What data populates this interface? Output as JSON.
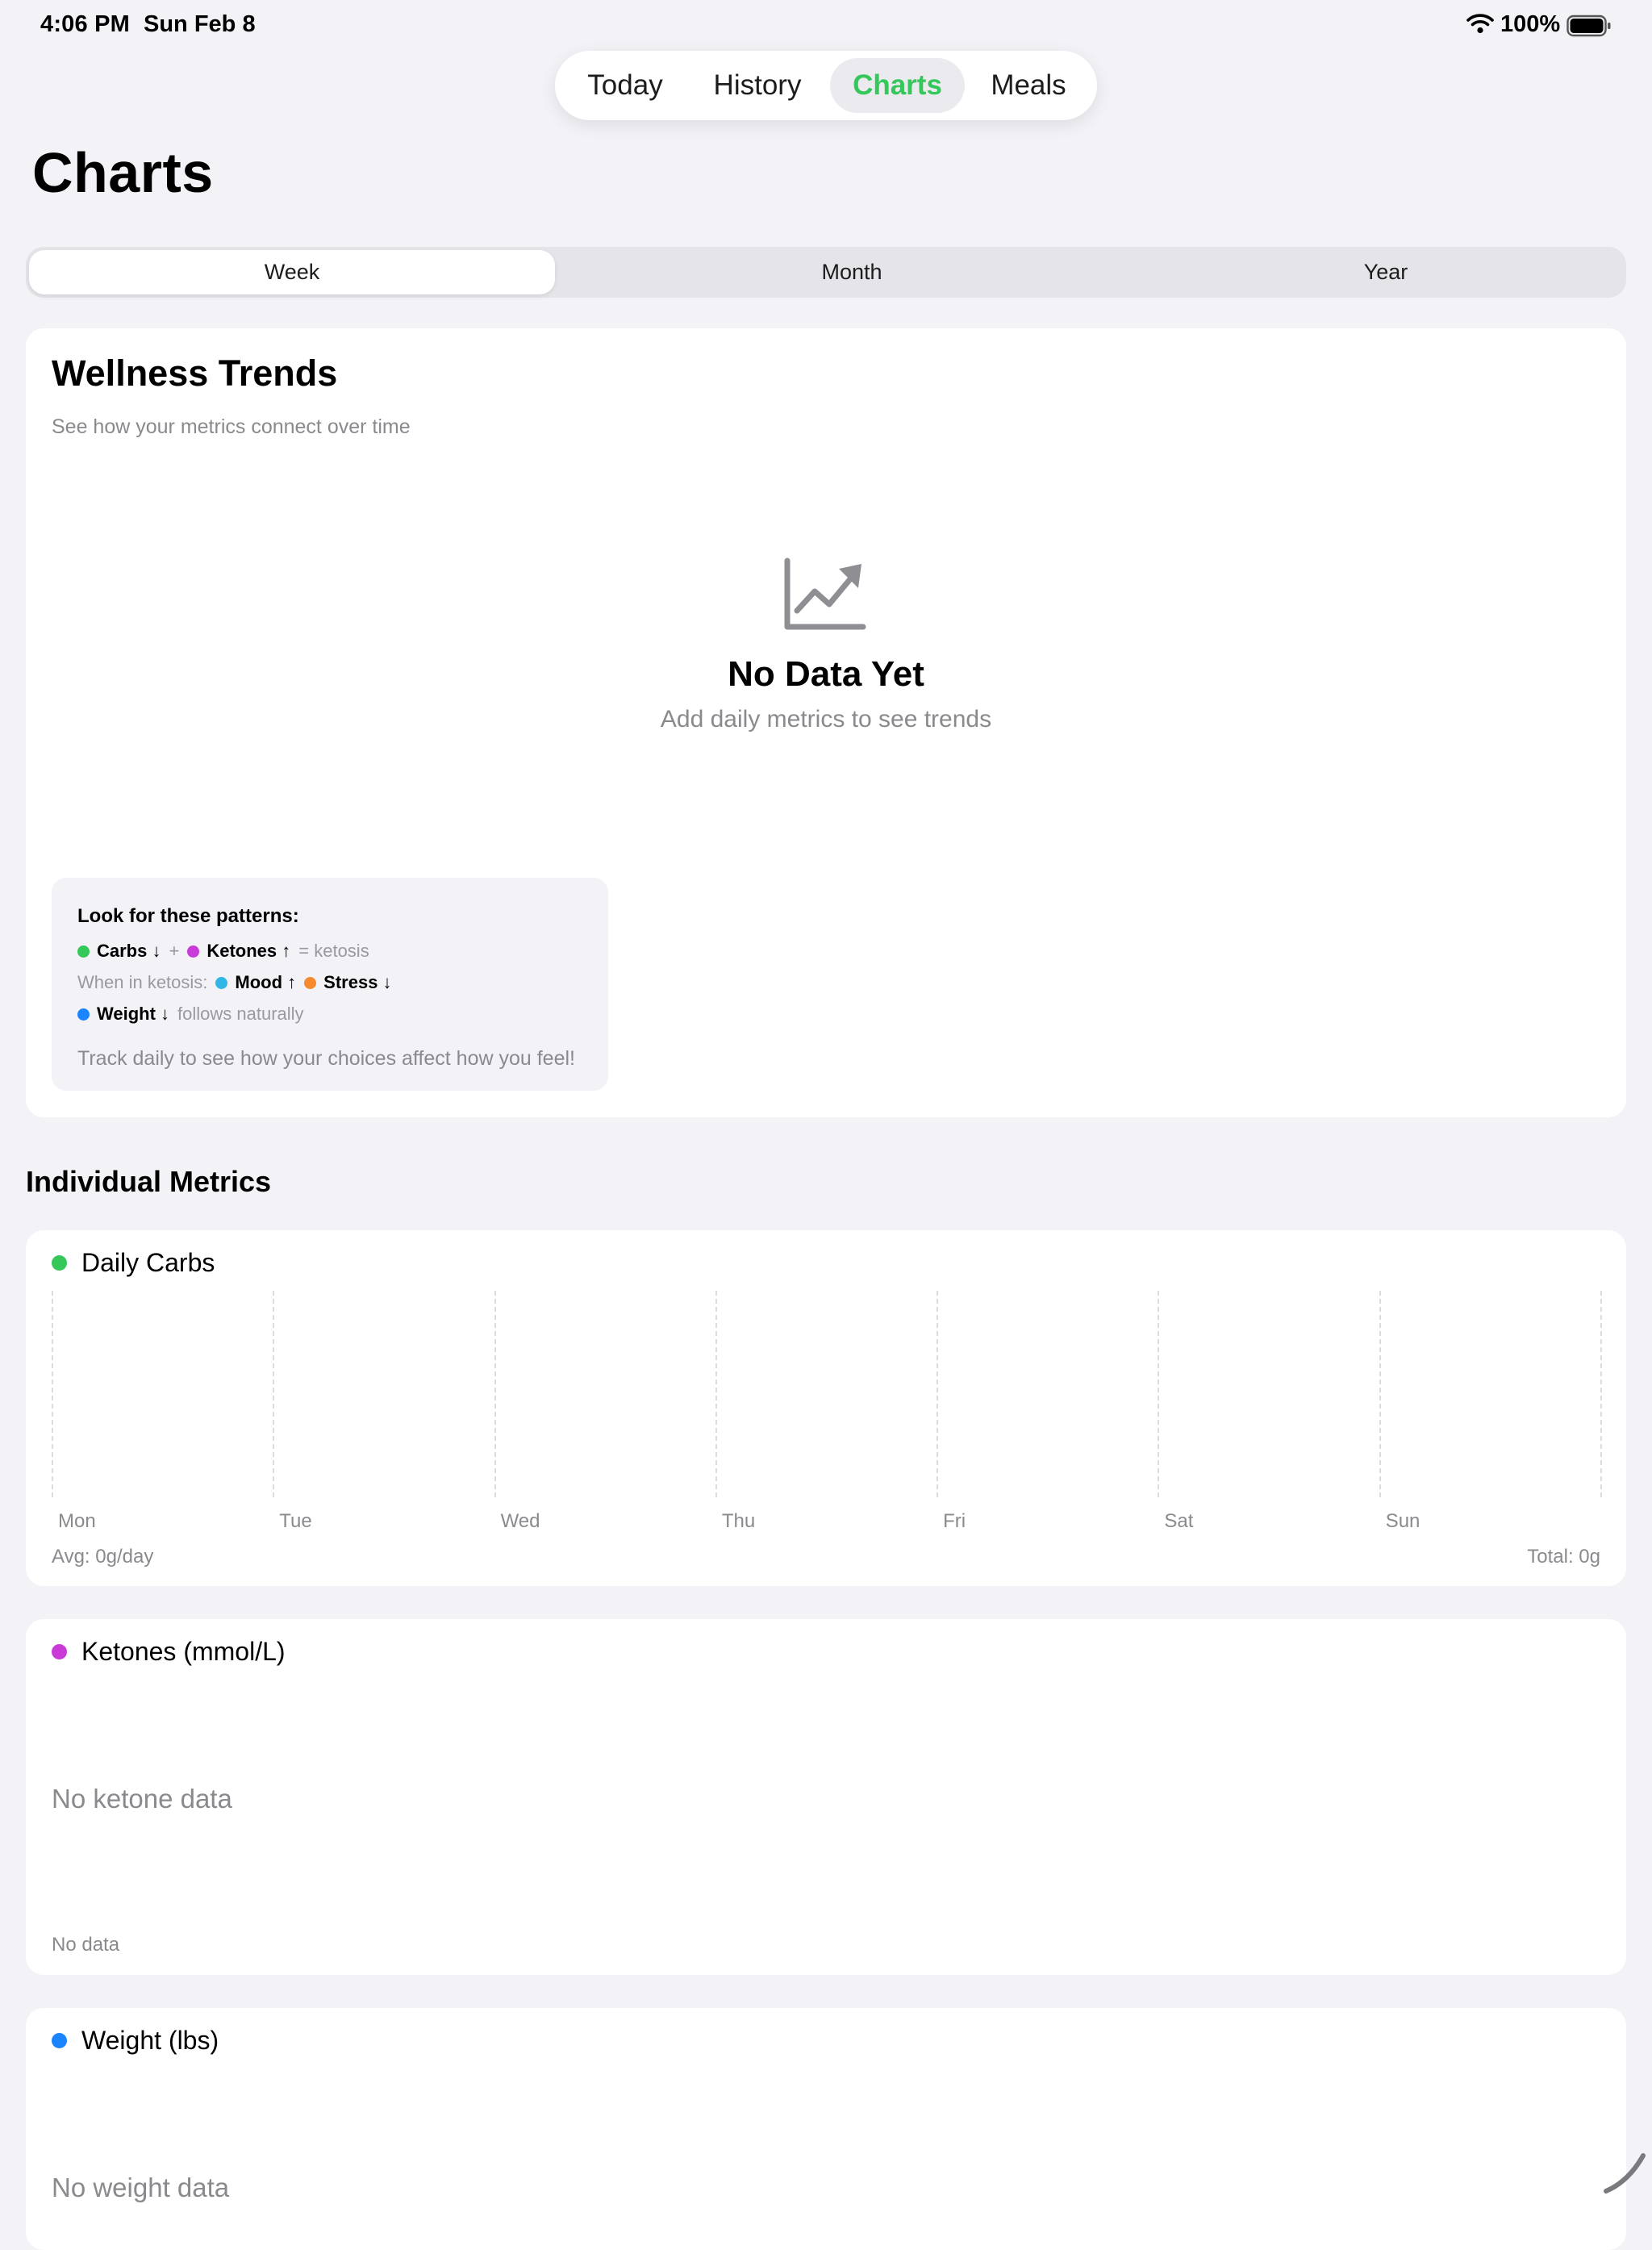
{
  "status_bar": {
    "time": "4:06 PM",
    "date": "Sun Feb 8",
    "battery": "100%"
  },
  "tabs": [
    {
      "label": "Today",
      "selected": false
    },
    {
      "label": "History",
      "selected": false
    },
    {
      "label": "Charts",
      "selected": true
    },
    {
      "label": "Meals",
      "selected": false
    }
  ],
  "page_title": "Charts",
  "segments": [
    {
      "label": "Week",
      "selected": true
    },
    {
      "label": "Month",
      "selected": false
    },
    {
      "label": "Year",
      "selected": false
    }
  ],
  "wellness": {
    "title": "Wellness Trends",
    "subtitle": "See how your metrics connect over time",
    "empty_icon": "chart-line-uptrend-icon",
    "empty_title": "No Data Yet",
    "empty_subtitle": "Add daily metrics to see trends",
    "patterns": {
      "title": "Look for these patterns:",
      "carbs": "Carbs ↓",
      "plus": "+",
      "ketones": "Ketones ↑",
      "ketosis": "= ketosis",
      "when_in_ketosis": "When in ketosis:",
      "mood": "Mood ↑",
      "stress": "Stress ↓",
      "weight": "Weight ↓",
      "follows": "follows naturally",
      "footer": "Track daily to see how your choices affect how you feel!"
    }
  },
  "section_title": "Individual Metrics",
  "carbs": {
    "title": "Daily Carbs",
    "days": [
      "Mon",
      "Tue",
      "Wed",
      "Thu",
      "Fri",
      "Sat",
      "Sun"
    ],
    "avg": "Avg: 0g/day",
    "total": "Total: 0g"
  },
  "ketones": {
    "title": "Ketones (mmol/L)",
    "empty": "No ketone data",
    "footer": "No data"
  },
  "weight": {
    "title": "Weight (lbs)",
    "empty": "No weight data"
  },
  "colors": {
    "accent_green": "#34c759",
    "carbs": "#34c759",
    "ketones": "#c93ad8",
    "mood": "#32b6e6",
    "stress": "#f58a2e",
    "weight": "#1b84ff",
    "background": "#f2f2f7"
  }
}
